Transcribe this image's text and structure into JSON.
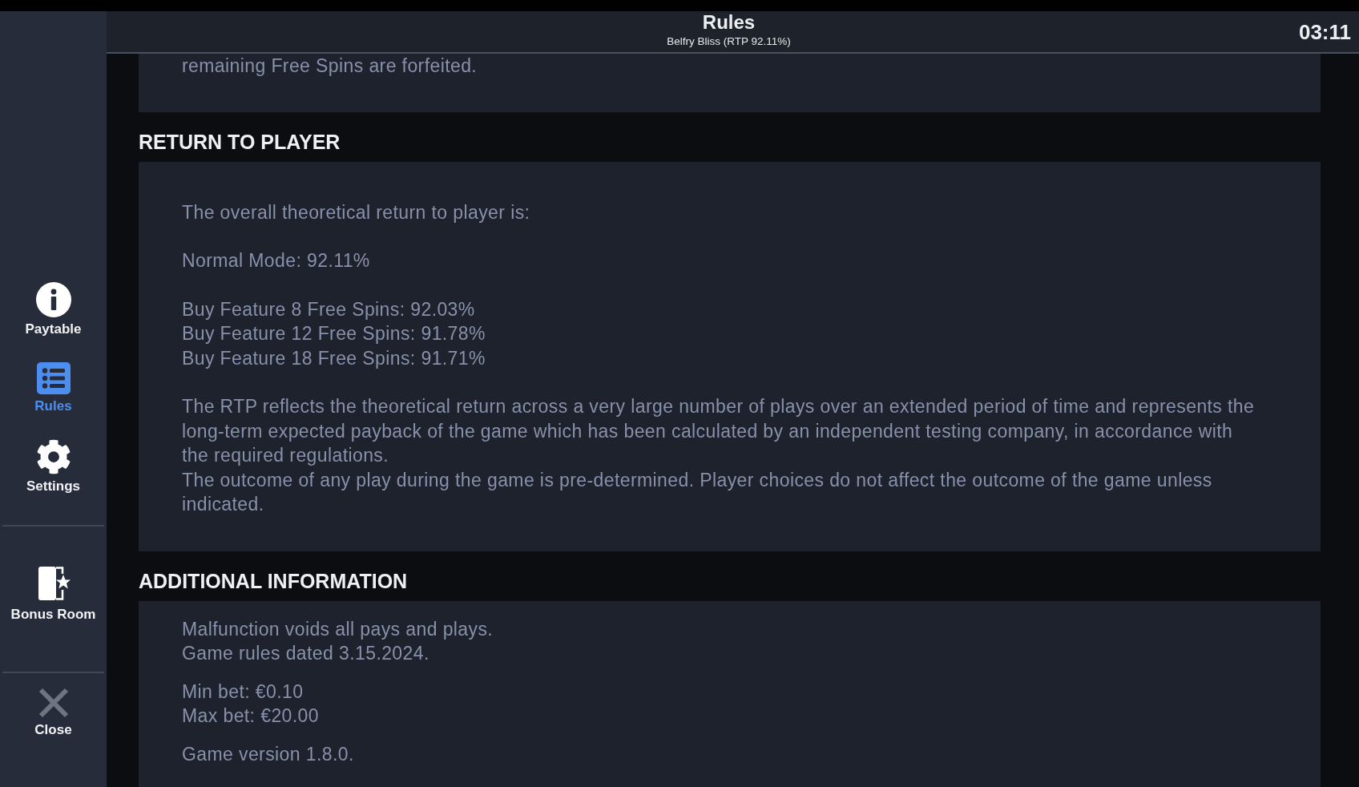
{
  "header": {
    "title": "Rules",
    "subtitle": "Belfry Bliss (RTP 92.11%)",
    "clock": "03:11"
  },
  "sidebar": {
    "groups": [
      {
        "items": [
          {
            "kind": "paytable",
            "label": "Paytable",
            "selected": false
          },
          {
            "kind": "rules",
            "label": "Rules",
            "selected": true
          },
          {
            "kind": "settings",
            "label": "Settings",
            "selected": false
          }
        ]
      },
      {
        "items": [
          {
            "kind": "bonus",
            "label": "Bonus Room",
            "selected": false
          }
        ]
      },
      {
        "items": [
          {
            "kind": "close",
            "label": "Close",
            "selected": false
          }
        ]
      }
    ]
  },
  "sections": [
    {
      "blocks": [
        [
          "remaining Free Spins are forfeited."
        ]
      ]
    },
    {
      "heading": "RETURN TO PLAYER",
      "blocks": [
        [
          "The overall theoretical return to player is:"
        ],
        [
          "Normal Mode: 92.11%"
        ],
        [
          "Buy Feature 8 Free Spins: 92.03%",
          "Buy Feature 12 Free Spins: 91.78%",
          "Buy Feature 18 Free Spins: 91.71%"
        ],
        [
          "The RTP reflects the theoretical return across a very large number of plays over an extended period of time and represents the long-term expected payback of the game which has been calculated by an independent testing company, in accordance with the required regulations.",
          "The outcome of any play during the game is pre-determined. Player choices do not affect the outcome of the game unless indicated."
        ]
      ]
    },
    {
      "heading": "ADDITIONAL INFORMATION",
      "blocks": [
        [
          "Malfunction voids all pays and plays.",
          "Game rules dated 3.15.2024."
        ],
        [
          "Min bet: €0.10",
          "Max bet: €20.00"
        ],
        [
          "Game version 1.8.0."
        ]
      ]
    }
  ]
}
